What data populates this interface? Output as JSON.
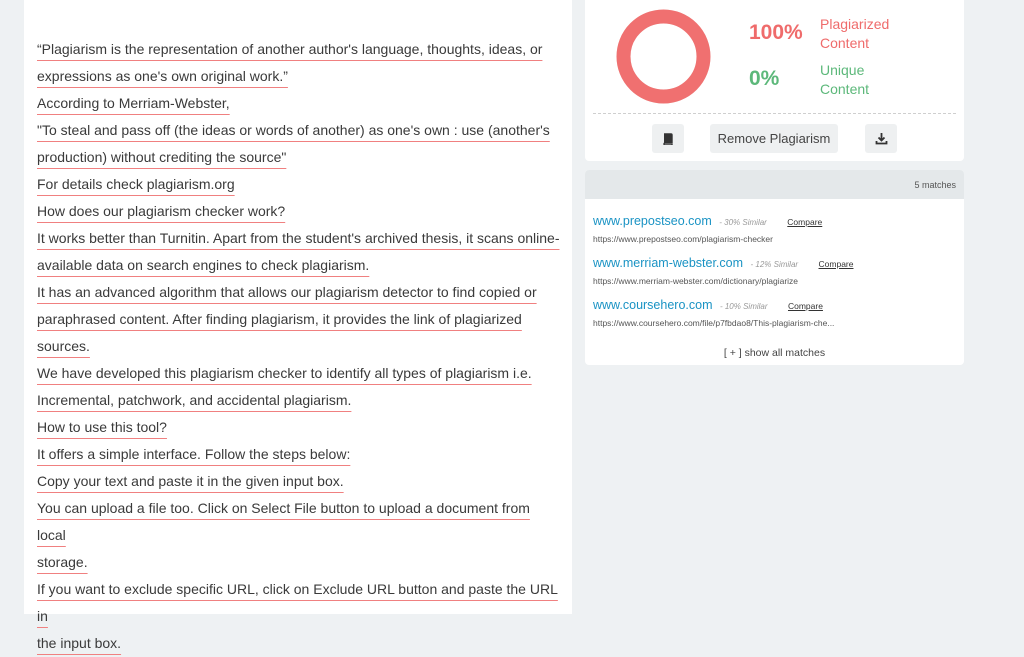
{
  "text_lines": [
    [
      "“Plagiarism is the representation of another author's language, thoughts, ideas, or",
      "expressions as one's own original work.”"
    ],
    [
      "According to Merriam-Webster,"
    ],
    [
      "\"To steal and pass off (the ideas or words of another) as one's own : use (another's",
      "production) without crediting the source\""
    ],
    [
      "For details check plagiarism.org"
    ],
    [
      "How does our plagiarism checker work?"
    ],
    [
      "It works better than Turnitin. Apart from the student's archived thesis, it scans online-",
      "available data on search engines to check plagiarism."
    ],
    [
      "It has an advanced algorithm that allows our plagiarism detector to find copied or",
      "paraphrased content. After finding plagiarism, it provides the link of plagiarized",
      "sources."
    ],
    [
      "We have developed this plagiarism checker to identify all types of plagiarism i.e.",
      "Incremental, patchwork, and accidental plagiarism."
    ],
    [
      "How to use this tool?"
    ],
    [
      "It offers a simple interface. Follow the steps below:"
    ],
    [
      "Copy your text and paste it in the given input box."
    ],
    [
      "You can upload a file too. Click on Select File button to upload a document from local",
      "storage."
    ],
    [
      "If you want to exclude specific URL, click on Exclude URL button and paste the URL in",
      "the input box."
    ]
  ],
  "result": {
    "plagiarized_pct": "100%",
    "plagiarized_label": "Plagiarized Content",
    "unique_pct": "0%",
    "unique_label": "Unique Content",
    "plagiarized_fraction": 1.0,
    "plagiarized_color": "#f07070",
    "unique_color": "#5cb87a"
  },
  "actions": {
    "remove_label": "Remove Plagiarism",
    "book_icon": "book-icon",
    "download_icon": "download-icon"
  },
  "matches": {
    "count_label": "5 matches",
    "items": [
      {
        "domain": "www.prepostseo.com",
        "similar": "- 30% Similar",
        "compare": "Compare",
        "url": "https://www.prepostseo.com/plagiarism-checker"
      },
      {
        "domain": "www.merriam-webster.com",
        "similar": "- 12% Similar",
        "compare": "Compare",
        "url": "https://www.merriam-webster.com/dictionary/plagiarize"
      },
      {
        "domain": "www.coursehero.com",
        "similar": "- 10% Similar",
        "compare": "Compare",
        "url": "https://www.coursehero.com/file/p7fbdao8/This-plagiarism-che..."
      }
    ],
    "show_all": "[ + ] show all matches"
  }
}
